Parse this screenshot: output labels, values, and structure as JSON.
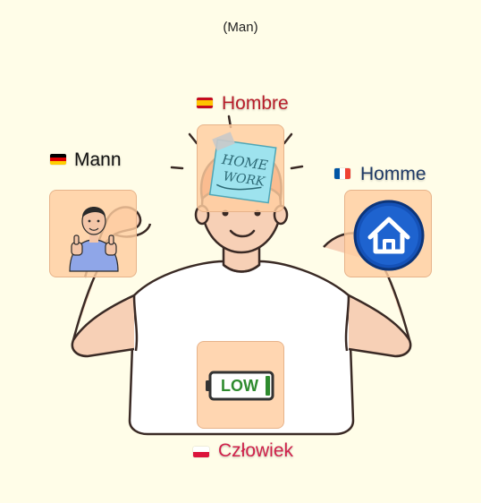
{
  "caption": "(Man)",
  "words": {
    "spanish": "Hombre",
    "german": "Mann",
    "french": "Homme",
    "polish": "Człowiek"
  },
  "battery_label": "LOW",
  "note_text": "HOME WORK",
  "colors": {
    "background": "#fffde8",
    "spanish_word": "#b81d2a",
    "german_word": "#111111",
    "french_word": "#1f3a66",
    "polish_word": "#d0214a",
    "card": "#ffcda0",
    "battery_green": "#2e8b2e",
    "house_blue": "#1552b8"
  },
  "icons": [
    "man-illustration",
    "sticky-note-icon",
    "thumbs-up-person-icon",
    "house-icon",
    "low-battery-icon"
  ]
}
